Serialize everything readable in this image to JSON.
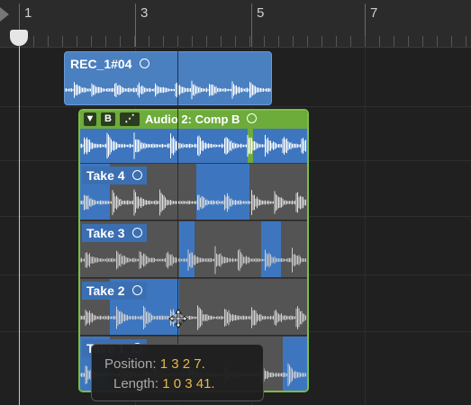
{
  "ruler": {
    "bar_numbers": [
      "1",
      "3",
      "5",
      "7"
    ]
  },
  "regions": {
    "rec": {
      "name": "REC_1#04"
    },
    "comp": {
      "buttons": [
        "▼",
        "B",
        "⋰"
      ],
      "name": "Audio 2: Comp B",
      "takes": [
        "Take 4",
        "Take 3",
        "Take 2",
        "Take 1"
      ]
    }
  },
  "tooltip": {
    "position_label": "Position:",
    "position_value": "1 3 2 7.",
    "length_label": "Length:",
    "length_value": "1 0 3 41."
  },
  "colors": {
    "audio_region": "#4a7fc0",
    "comp_folder": "#6dab3b",
    "take_lane": "#545454",
    "tooltip_value": "#e8b84a"
  },
  "icons": [
    "playhead-icon",
    "move-cursor-icon",
    "loop-icon",
    "disclosure-triangle-icon",
    "quick-swipe-icon"
  ]
}
